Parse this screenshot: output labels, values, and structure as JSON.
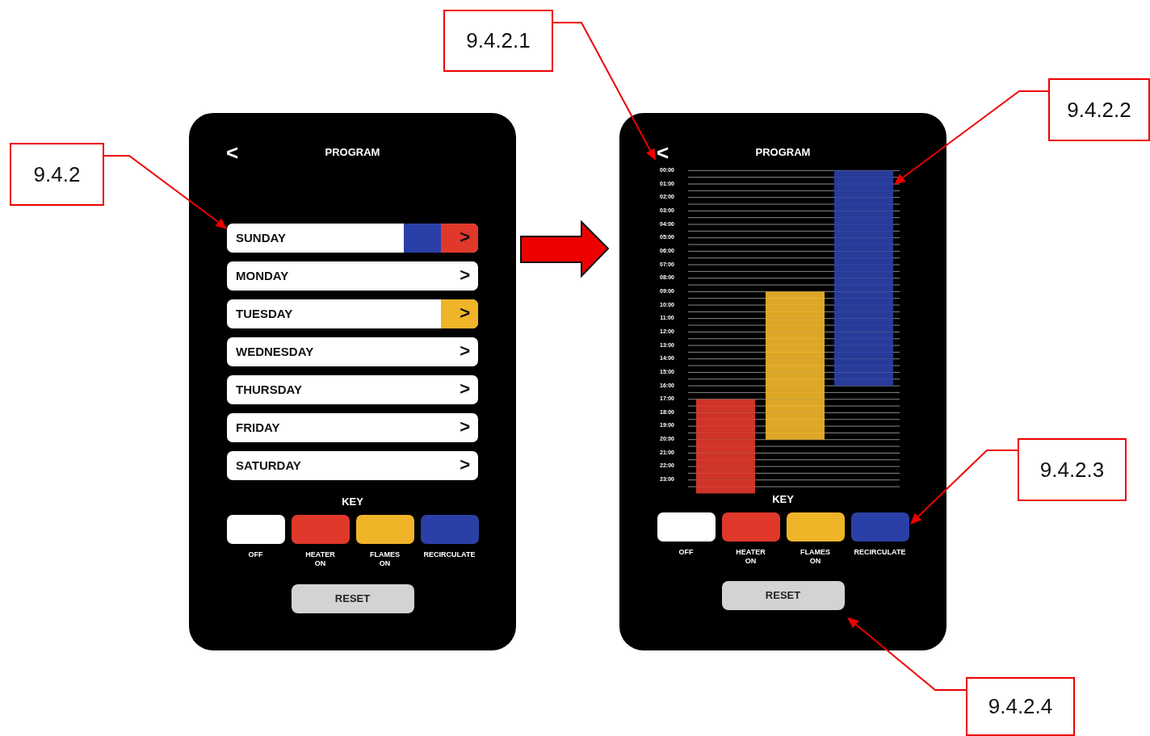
{
  "callouts": [
    {
      "label": "9.4.2"
    },
    {
      "label": "9.4.2.1"
    },
    {
      "label": "9.4.2.2"
    },
    {
      "label": "9.4.2.3"
    },
    {
      "label": "9.4.2.4"
    }
  ],
  "day_screen": {
    "back": "<",
    "title": "PROGRAM",
    "days": [
      {
        "name": "SUNDAY",
        "arrow": ">",
        "segments": [
          {
            "color": "#2b40a6"
          },
          {
            "color": "#e0382b"
          }
        ]
      },
      {
        "name": "MONDAY",
        "arrow": ">"
      },
      {
        "name": "TUESDAY",
        "arrow": ">",
        "segments": [
          {
            "color": "#f0b429"
          }
        ]
      },
      {
        "name": "WEDNESDAY",
        "arrow": ">"
      },
      {
        "name": "THURSDAY",
        "arrow": ">"
      },
      {
        "name": "FRIDAY",
        "arrow": ">"
      },
      {
        "name": "SATURDAY",
        "arrow": ">"
      }
    ],
    "key_title": "KEY",
    "key": [
      {
        "label": "OFF",
        "color": "#ffffff"
      },
      {
        "label": "HEATER\nON",
        "color": "#e0382b"
      },
      {
        "label": "FLAMES\nON",
        "color": "#f0b429"
      },
      {
        "label": "RECIRCULATE",
        "color": "#2b40a6"
      }
    ],
    "reset": "RESET"
  },
  "schedule_screen": {
    "back": "<",
    "title": "PROGRAM",
    "hours": [
      {
        "label": "00:00",
        "heater_on": false,
        "flames_on": false,
        "recirculate": true
      },
      {
        "label": "01:00",
        "heater_on": false,
        "flames_on": false,
        "recirculate": true
      },
      {
        "label": "02:00",
        "heater_on": false,
        "flames_on": false,
        "recirculate": true
      },
      {
        "label": "03:00",
        "heater_on": false,
        "flames_on": false,
        "recirculate": true
      },
      {
        "label": "04:00",
        "heater_on": false,
        "flames_on": false,
        "recirculate": true
      },
      {
        "label": "05:00",
        "heater_on": false,
        "flames_on": false,
        "recirculate": true
      },
      {
        "label": "06:00",
        "heater_on": false,
        "flames_on": false,
        "recirculate": true
      },
      {
        "label": "07:00",
        "heater_on": false,
        "flames_on": false,
        "recirculate": true
      },
      {
        "label": "08:00",
        "heater_on": false,
        "flames_on": false,
        "recirculate": true
      },
      {
        "label": "09:00",
        "heater_on": false,
        "flames_on": true,
        "recirculate": true
      },
      {
        "label": "10:00",
        "heater_on": false,
        "flames_on": true,
        "recirculate": true
      },
      {
        "label": "11:00",
        "heater_on": false,
        "flames_on": true,
        "recirculate": true
      },
      {
        "label": "12:00",
        "heater_on": false,
        "flames_on": true,
        "recirculate": true
      },
      {
        "label": "13:00",
        "heater_on": false,
        "flames_on": true,
        "recirculate": true
      },
      {
        "label": "14:00",
        "heater_on": false,
        "flames_on": true,
        "recirculate": true
      },
      {
        "label": "15:00",
        "heater_on": false,
        "flames_on": true,
        "recirculate": true
      },
      {
        "label": "16:00",
        "heater_on": false,
        "flames_on": true,
        "recirculate": false
      },
      {
        "label": "17:00",
        "heater_on": true,
        "flames_on": true,
        "recirculate": false
      },
      {
        "label": "18:00",
        "heater_on": true,
        "flames_on": true,
        "recirculate": false
      },
      {
        "label": "19:00",
        "heater_on": true,
        "flames_on": true,
        "recirculate": false
      },
      {
        "label": "20:00",
        "heater_on": true,
        "flames_on": false,
        "recirculate": false
      },
      {
        "label": "21:00",
        "heater_on": true,
        "flames_on": false,
        "recirculate": false
      },
      {
        "label": "22:00",
        "heater_on": true,
        "flames_on": false,
        "recirculate": false
      },
      {
        "label": "23:00",
        "heater_on": true,
        "flames_on": false,
        "recirculate": false
      }
    ],
    "key_title": "KEY",
    "key": [
      {
        "label": "OFF",
        "color": "#ffffff"
      },
      {
        "label": "HEATER\nON",
        "color": "#e0382b"
      },
      {
        "label": "FLAMES\nON",
        "color": "#f0b429"
      },
      {
        "label": "RECIRCULATE",
        "color": "#2b40a6"
      }
    ],
    "reset": "RESET"
  }
}
